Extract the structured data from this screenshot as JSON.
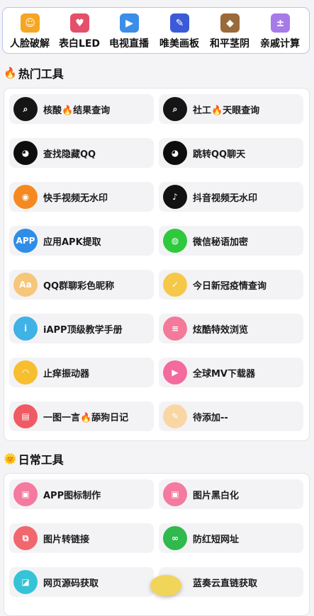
{
  "top_nav": [
    {
      "label": "人脸破解",
      "icon": "face-unlock-icon",
      "color": "#f5a623",
      "glyph": "☺"
    },
    {
      "label": "表白LED",
      "icon": "led-heart-icon",
      "color": "#e4506a",
      "glyph": "♥"
    },
    {
      "label": "电视直播",
      "icon": "tv-camera-icon",
      "color": "#3b8ee8",
      "glyph": "▶"
    },
    {
      "label": "唯美画板",
      "icon": "paintbrush-icon",
      "color": "#3b5bd6",
      "glyph": "✎"
    },
    {
      "label": "和平茎阴",
      "icon": "game-avatar-icon",
      "color": "#9a6a3a",
      "glyph": "◆"
    },
    {
      "label": "亲戚计算",
      "icon": "calculator-icon",
      "color": "#a67be8",
      "glyph": "±"
    }
  ],
  "sections": [
    {
      "title": "热门工具",
      "emoji": "🔥",
      "tools": [
        {
          "label": "核酸🔥结果查询",
          "icon": "search-icon",
          "color": "#151515",
          "glyph": "⌕"
        },
        {
          "label": "社工🔥天眼查询",
          "icon": "search-icon",
          "color": "#151515",
          "glyph": "⌕"
        },
        {
          "label": "查找隐藏QQ",
          "icon": "qq-ghost-icon",
          "color": "#0d0d0d",
          "glyph": "◕"
        },
        {
          "label": "跳转QQ聊天",
          "icon": "qq-ghost-icon",
          "color": "#0d0d0d",
          "glyph": "◕"
        },
        {
          "label": "快手视频无水印",
          "icon": "kuaishou-icon",
          "color": "#f5891f",
          "glyph": "◉"
        },
        {
          "label": "抖音视频无水印",
          "icon": "tiktok-icon",
          "color": "#111111",
          "glyph": "♪"
        },
        {
          "label": "应用APK提取",
          "icon": "app-icon",
          "color": "#2f8de8",
          "glyph": "APP"
        },
        {
          "label": "微信秘语加密",
          "icon": "wechat-icon",
          "color": "#2ec93c",
          "glyph": "◍"
        },
        {
          "label": "QQ群聊彩色昵称",
          "icon": "font-aa-icon",
          "color": "#f6c77a",
          "glyph": "Aa"
        },
        {
          "label": "今日新冠疫情查询",
          "icon": "shield-check-icon",
          "color": "#f5c84a",
          "glyph": "✓"
        },
        {
          "label": "iAPP顶级教学手册",
          "icon": "info-i-icon",
          "color": "#3fb2e6",
          "glyph": "i"
        },
        {
          "label": "炫酷特效浏览",
          "icon": "list-doc-icon",
          "color": "#f37a9a",
          "glyph": "≡"
        },
        {
          "label": "止痒振动器",
          "icon": "fan-icon",
          "color": "#f7be2f",
          "glyph": "◠"
        },
        {
          "label": "全球MV下载器",
          "icon": "video-icon",
          "color": "#f46a9e",
          "glyph": "▶"
        },
        {
          "label": "一图一言🔥舔狗日记",
          "icon": "card-icon",
          "color": "#f05a64",
          "glyph": "▤"
        },
        {
          "label": "待添加--",
          "icon": "pencil-icon",
          "color": "#f9d7a4",
          "glyph": "✎"
        }
      ]
    },
    {
      "title": "日常工具",
      "emoji": "🌞",
      "tools": [
        {
          "label": "APP图标制作",
          "icon": "image-icon",
          "color": "#f47aa0",
          "glyph": "▣"
        },
        {
          "label": "图片黑白化",
          "icon": "image-icon",
          "color": "#f47aa0",
          "glyph": "▣"
        },
        {
          "label": "图片转链接",
          "icon": "copy-icon",
          "color": "#f0676e",
          "glyph": "⧉"
        },
        {
          "label": "防红短网址",
          "icon": "link-icon",
          "color": "#30b94c",
          "glyph": "∞"
        },
        {
          "label": "网页源码获取",
          "icon": "code-doc-icon",
          "color": "#36c3d8",
          "glyph": "◪"
        },
        {
          "label": "蓝奏云直链获取",
          "icon": "lanzou-icon",
          "color": "#f2f2f2",
          "glyph": "◆"
        }
      ]
    }
  ]
}
